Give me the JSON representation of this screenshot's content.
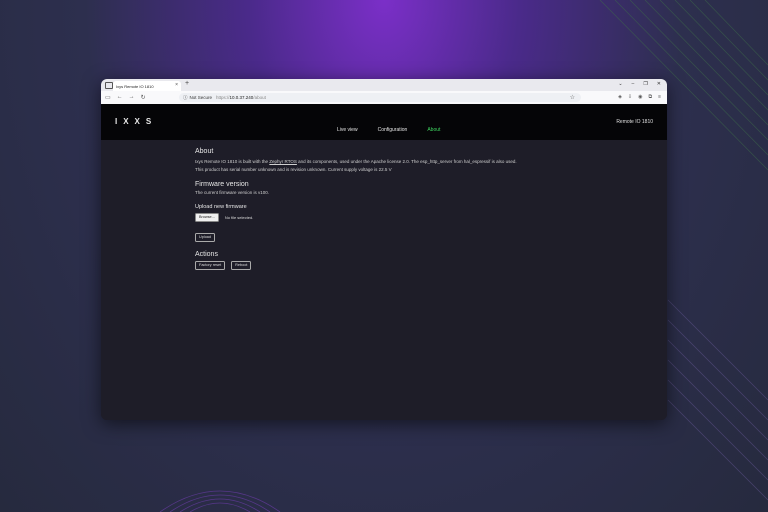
{
  "browser": {
    "tab_title": "Ixys Remote IO 1810",
    "new_tab": "+",
    "close_tab": "×",
    "window_controls": [
      "⌄",
      "–",
      "❐",
      "✕"
    ],
    "not_secure": "Not Secure",
    "url_protocol": "https://",
    "url_host": "10.0.37.240",
    "url_path": "/about"
  },
  "header": {
    "logo": "IXXS",
    "device_name": "Remote IO 1810",
    "nav": [
      {
        "label": "Live view",
        "active": false
      },
      {
        "label": "Configuration",
        "active": false
      },
      {
        "label": "About",
        "active": true
      }
    ]
  },
  "about": {
    "heading": "About",
    "line1_pre": "Ixys Remote IO 1810 is built with the ",
    "line1_link": "Zephyr RTOS",
    "line1_post": " and its components, used under the Apache license 2.0. The esp_http_server from hal_espressif is also used.",
    "line2": "This product has serial number unknown and is revision unknown. Current supply voltage is 22.5 V"
  },
  "firmware": {
    "heading": "Firmware version",
    "current": "The current firmware version is v100.",
    "upload_heading": "Upload new firmware",
    "browse_label": "Browse...",
    "no_file": "No file selected.",
    "upload_label": "Upload"
  },
  "actions": {
    "heading": "Actions",
    "factory_reset": "Factory reset",
    "reboot": "Reboot"
  },
  "colors": {
    "accent": "#3ed660",
    "page_bg": "#1e1d28",
    "header_bg": "#050507"
  }
}
